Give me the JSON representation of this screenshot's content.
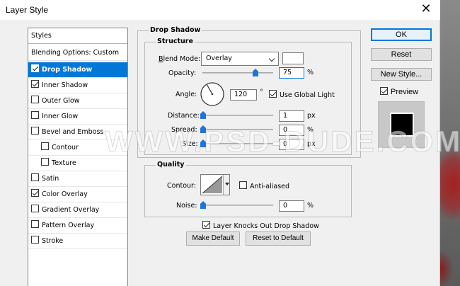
{
  "window": {
    "title": "Layer Style",
    "close_glyph": "✕"
  },
  "styles_list": {
    "header": "Styles",
    "blending": "Blending Options: Custom",
    "items": [
      {
        "label": "Drop Shadow",
        "checked": true,
        "selected": true
      },
      {
        "label": "Inner Shadow",
        "checked": true
      },
      {
        "label": "Outer Glow",
        "checked": false
      },
      {
        "label": "Inner Glow",
        "checked": false
      },
      {
        "label": "Bevel and Emboss",
        "checked": false
      },
      {
        "label": "Contour",
        "checked": false,
        "indent": true
      },
      {
        "label": "Texture",
        "checked": false,
        "indent": true
      },
      {
        "label": "Satin",
        "checked": false
      },
      {
        "label": "Color Overlay",
        "checked": true
      },
      {
        "label": "Gradient Overlay",
        "checked": false
      },
      {
        "label": "Pattern Overlay",
        "checked": false
      },
      {
        "label": "Stroke",
        "checked": false
      }
    ]
  },
  "drop_shadow": {
    "section_title": "Drop Shadow",
    "structure": {
      "title": "Structure",
      "blend_mode_label": "Blend Mode:",
      "blend_mode_value": "Overlay",
      "opacity_label": "Opacity:",
      "opacity_value": "75",
      "opacity_unit": "%",
      "opacity_level": 0.75,
      "angle_label": "Angle:",
      "angle_value": "120",
      "angle_unit": "°",
      "use_global_light_label": "Use Global Light",
      "use_global_light": true,
      "distance_label": "Distance:",
      "distance_value": "1",
      "distance_unit": "px",
      "spread_label": "Spread:",
      "spread_value": "0",
      "spread_unit": "%",
      "size_label": "Size:",
      "size_value": "0",
      "size_unit": "px"
    },
    "quality": {
      "title": "Quality",
      "contour_label": "Contour:",
      "anti_aliased_label": "Anti-aliased",
      "anti_aliased": false,
      "noise_label": "Noise:",
      "noise_value": "0",
      "noise_unit": "%"
    },
    "knocks_out_label": "Layer Knocks Out Drop Shadow",
    "knocks_out": true,
    "make_default_label": "Make Default",
    "reset_default_label": "Reset to Default"
  },
  "buttons": {
    "ok": "OK",
    "reset": "Reset",
    "new_style": "New Style...",
    "preview_label": "Preview",
    "preview_checked": true
  },
  "watermark": "WWW.PSD-DUDE.COM",
  "colors": {
    "accent": "#0078d7",
    "selected_row": "#0078d7",
    "slider_thumb": "#1e74d9"
  }
}
